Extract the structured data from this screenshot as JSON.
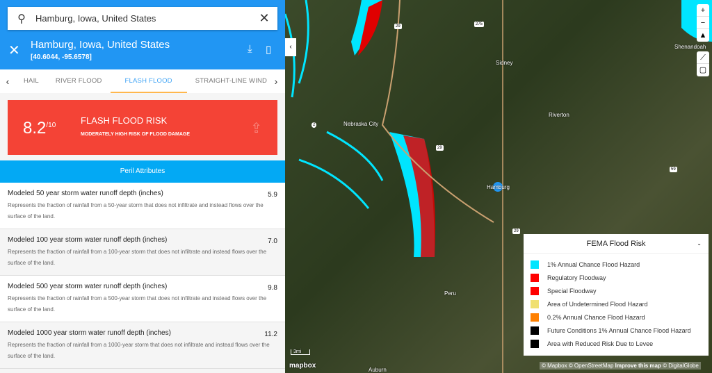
{
  "search": {
    "value": "Hamburg, Iowa, United States",
    "icon": "search-icon"
  },
  "location": {
    "title": "Hamburg, Iowa, United States",
    "coords": "[40.6044, -95.6578]"
  },
  "tabs": [
    {
      "label": "HAIL"
    },
    {
      "label": "RIVER FLOOD"
    },
    {
      "label": "FLASH FLOOD",
      "active": true
    },
    {
      "label": "STRAIGHT-LINE WIND"
    }
  ],
  "risk": {
    "score": "8.2",
    "max": "/10",
    "title": "FLASH FLOOD RISK",
    "subtitle": "MODERATELY HIGH RISK OF FLOOD DAMAGE",
    "color": "#f44336"
  },
  "peril_header": "Peril Attributes",
  "attributes": [
    {
      "name": "Modeled 50 year storm water runoff depth (inches)",
      "value": "5.9",
      "desc": "Represents the fraction of rainfall from a 50-year storm that does not infiltrate and instead flows over the surface of the land."
    },
    {
      "name": "Modeled 100 year storm water runoff depth (inches)",
      "value": "7.0",
      "desc": "Represents the fraction of rainfall from a 100-year storm that does not infiltrate and instead flows over the surface of the land."
    },
    {
      "name": "Modeled 500 year storm water runoff depth (inches)",
      "value": "9.8",
      "desc": "Represents the fraction of rainfall from a 500-year storm that does not infiltrate and instead flows over the surface of the land."
    },
    {
      "name": "Modeled 1000 year storm water runoff depth (inches)",
      "value": "11.2",
      "desc": "Represents the fraction of rainfall from a 1000-year storm that does not infiltrate and instead flows over the surface of the land."
    }
  ],
  "map": {
    "places": [
      "Nebraska City",
      "Sidney",
      "Riverton",
      "Hamburg",
      "Peru",
      "Auburn",
      "Shenandoah"
    ],
    "shields": [
      "29",
      "275",
      "2",
      "29",
      "59",
      "29"
    ],
    "scale": "3mi",
    "logo": "mapbox"
  },
  "legend": {
    "title": "FEMA Flood Risk",
    "items": [
      {
        "label": "1% Annual Chance Flood Hazard",
        "color": "#00e5ff"
      },
      {
        "label": "Regulatory Floodway",
        "color": "#ff0000"
      },
      {
        "label": "Special Floodway",
        "color": "#ff0000"
      },
      {
        "label": "Area of Undetermined Flood Hazard",
        "color": "#f0e070"
      },
      {
        "label": "0.2% Annual Chance Flood Hazard",
        "color": "#ff8000"
      },
      {
        "label": "Future Conditions 1% Annual Chance Flood Hazard",
        "color": "#000000"
      },
      {
        "label": "Area with Reduced Risk Due to Levee",
        "color": "#000000"
      }
    ]
  },
  "attribution": {
    "mapbox": "© Mapbox",
    "osm": "© OpenStreetMap",
    "improve": "Improve this map",
    "dg": "© DigitalGlobe"
  }
}
